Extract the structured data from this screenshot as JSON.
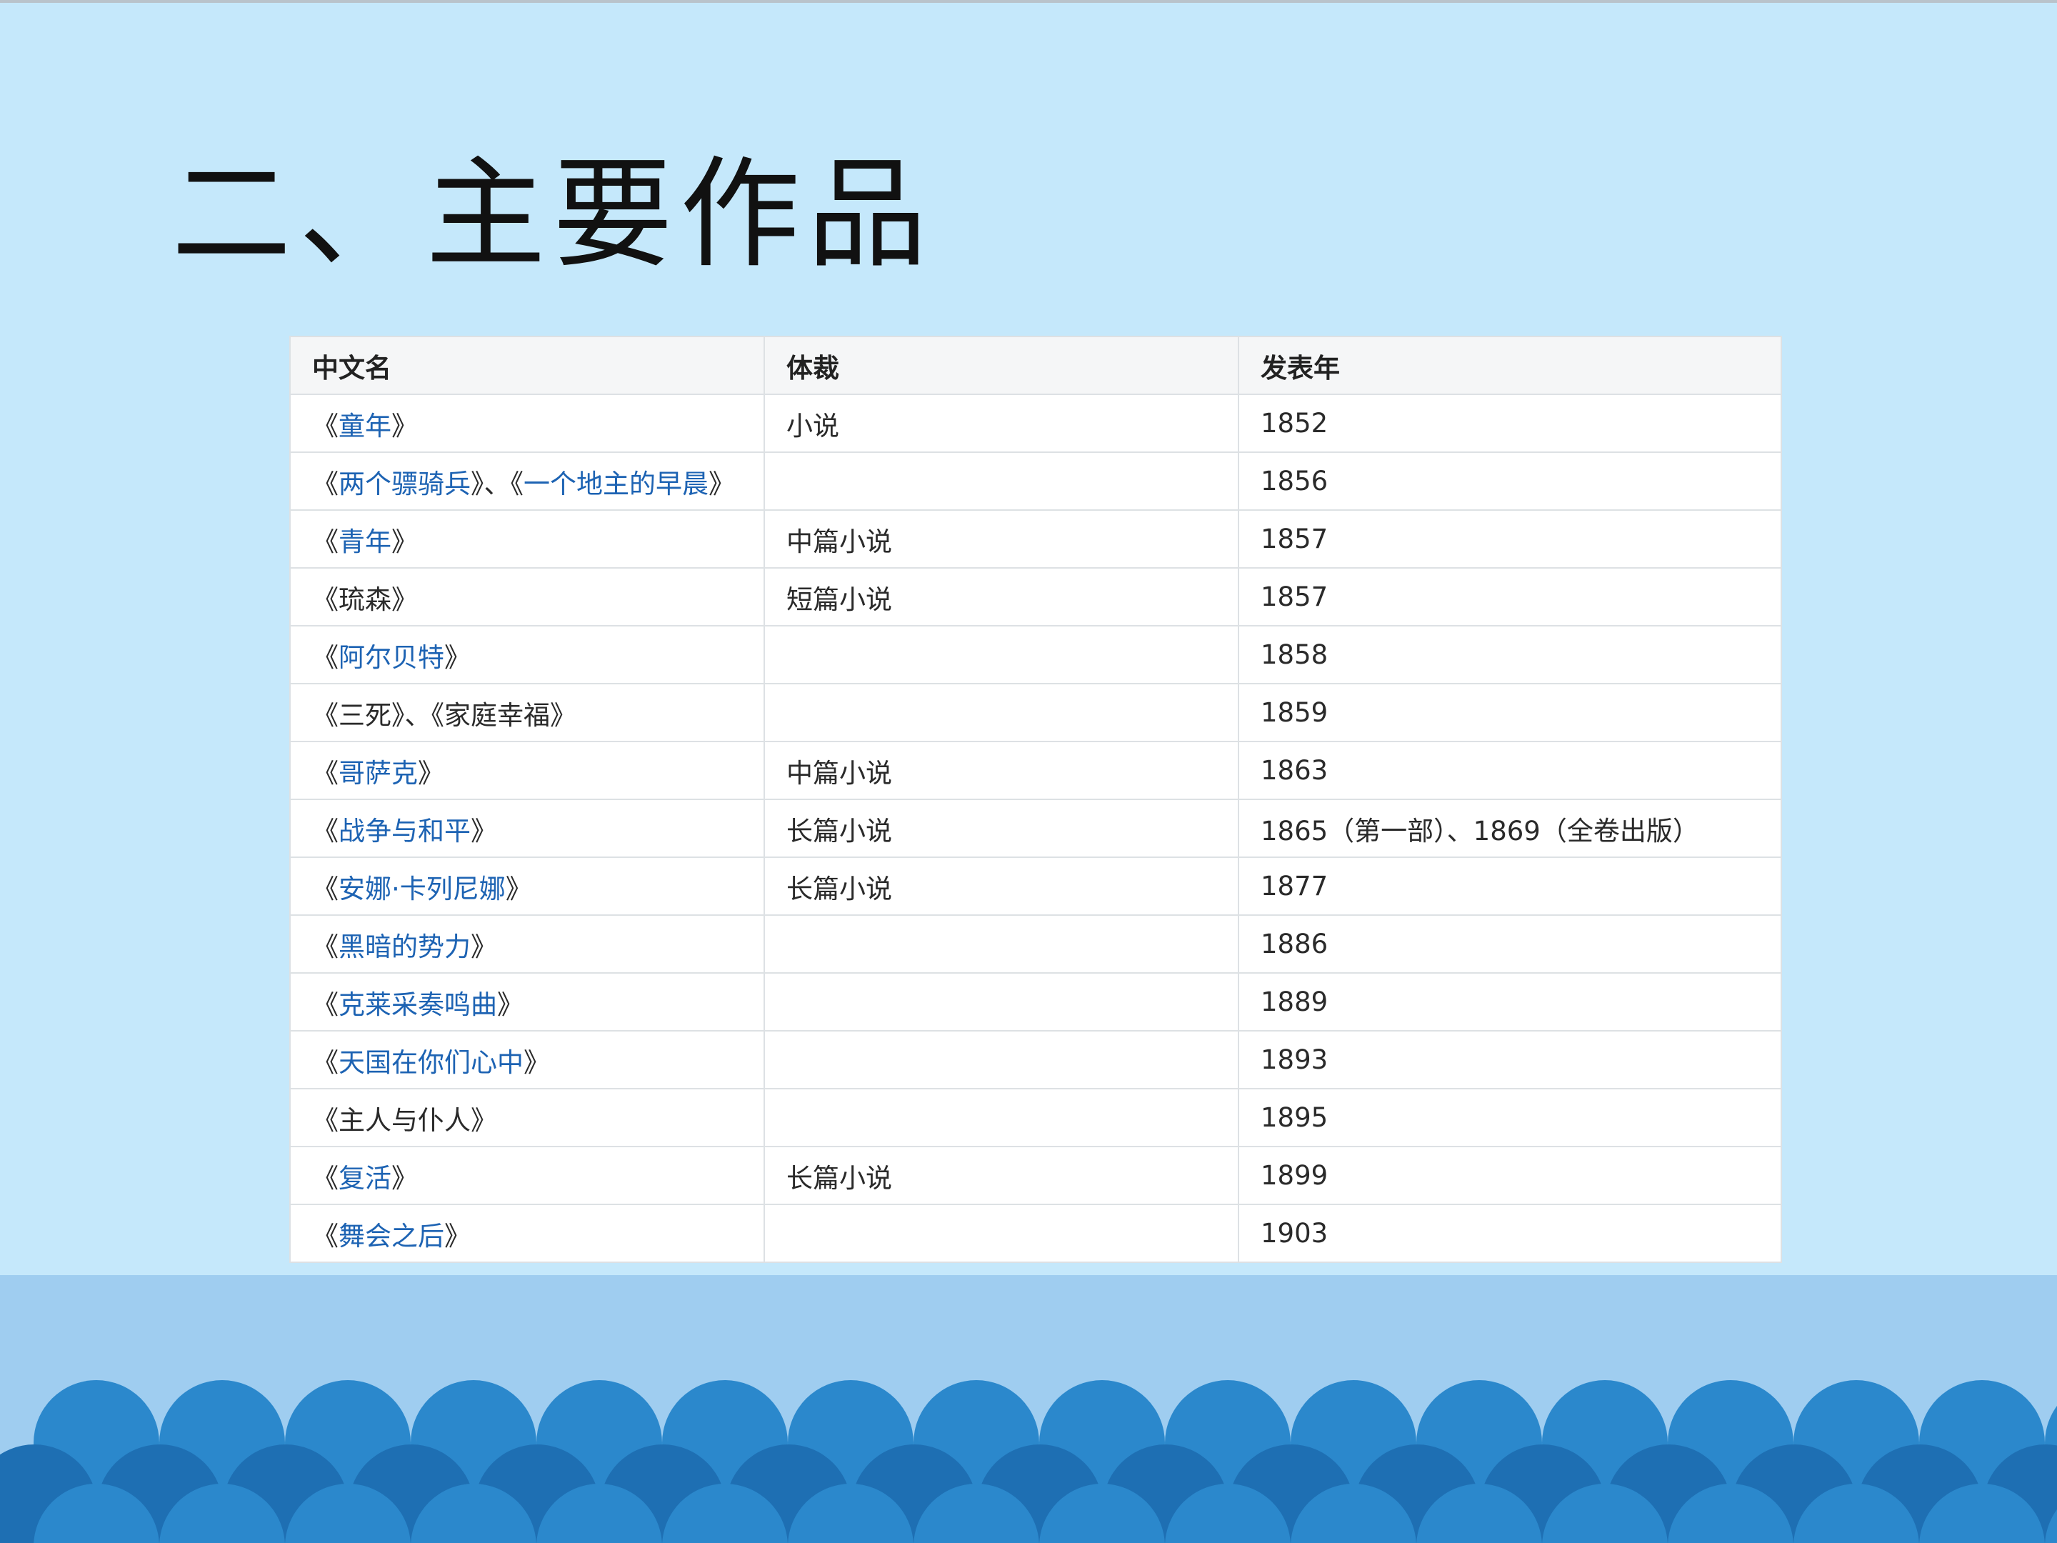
{
  "title": "二、主要作品",
  "table": {
    "headers": [
      "中文名",
      "体裁",
      "发表年"
    ],
    "rows": [
      {
        "name": [
          {
            "t": "《",
            "l": false
          },
          {
            "t": "童年",
            "l": true
          },
          {
            "t": "》",
            "l": false
          }
        ],
        "genre": "小说",
        "year": "1852"
      },
      {
        "name": [
          {
            "t": "《",
            "l": false
          },
          {
            "t": "两个骠骑兵",
            "l": true
          },
          {
            "t": "》、《",
            "l": false
          },
          {
            "t": "一个地主的早晨",
            "l": true
          },
          {
            "t": "》",
            "l": false
          }
        ],
        "genre": "",
        "year": "1856"
      },
      {
        "name": [
          {
            "t": "《",
            "l": false
          },
          {
            "t": "青年",
            "l": true
          },
          {
            "t": "》",
            "l": false
          }
        ],
        "genre": "中篇小说",
        "year": "1857"
      },
      {
        "name": [
          {
            "t": "《琉森》",
            "l": false
          }
        ],
        "genre": "短篇小说",
        "year": "1857"
      },
      {
        "name": [
          {
            "t": "《",
            "l": false
          },
          {
            "t": "阿尔贝特",
            "l": true
          },
          {
            "t": "》",
            "l": false
          }
        ],
        "genre": "",
        "year": "1858"
      },
      {
        "name": [
          {
            "t": "《三死》、《家庭幸福》",
            "l": false
          }
        ],
        "genre": "",
        "year": "1859"
      },
      {
        "name": [
          {
            "t": "《",
            "l": false
          },
          {
            "t": "哥萨克",
            "l": true
          },
          {
            "t": "》",
            "l": false
          }
        ],
        "genre": "中篇小说",
        "year": "1863"
      },
      {
        "name": [
          {
            "t": "《",
            "l": false
          },
          {
            "t": "战争与和平",
            "l": true
          },
          {
            "t": "》",
            "l": false
          }
        ],
        "genre": "长篇小说",
        "year": "1865（第一部）、1869（全卷出版）"
      },
      {
        "name": [
          {
            "t": "《",
            "l": false
          },
          {
            "t": "安娜·卡列尼娜",
            "l": true
          },
          {
            "t": "》",
            "l": false
          }
        ],
        "genre": "长篇小说",
        "year": "1877"
      },
      {
        "name": [
          {
            "t": "《",
            "l": false
          },
          {
            "t": "黑暗的势力",
            "l": true
          },
          {
            "t": "》",
            "l": false
          }
        ],
        "genre": "",
        "year": "1886"
      },
      {
        "name": [
          {
            "t": "《",
            "l": false
          },
          {
            "t": "克莱采奏鸣曲",
            "l": true
          },
          {
            "t": "》",
            "l": false
          }
        ],
        "genre": "",
        "year": "1889"
      },
      {
        "name": [
          {
            "t": "《",
            "l": false
          },
          {
            "t": "天国在你们心中",
            "l": true
          },
          {
            "t": "》",
            "l": false
          }
        ],
        "genre": "",
        "year": "1893"
      },
      {
        "name": [
          {
            "t": "《主人与仆人》",
            "l": false
          }
        ],
        "genre": "",
        "year": "1895"
      },
      {
        "name": [
          {
            "t": "《",
            "l": false
          },
          {
            "t": "复活",
            "l": true
          },
          {
            "t": "》",
            "l": false
          }
        ],
        "genre": "长篇小说",
        "year": "1899"
      },
      {
        "name": [
          {
            "t": "《",
            "l": false
          },
          {
            "t": "舞会之后",
            "l": true
          },
          {
            "t": "》",
            "l": false
          }
        ],
        "genre": "",
        "year": "1903"
      }
    ]
  },
  "colors": {
    "background": "#c5e8fb",
    "band": "#9fcdf0",
    "wave_front": "#2b88cc",
    "wave_back": "#1e6fb3",
    "link": "#1d63b3"
  }
}
